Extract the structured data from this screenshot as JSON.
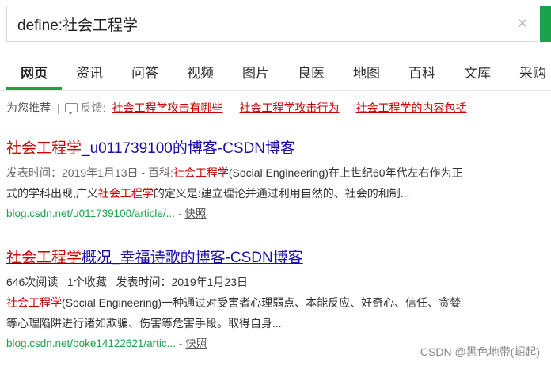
{
  "search": {
    "query": "define:社会工程学",
    "clear_icon": "close-icon"
  },
  "tabs": [
    "网页",
    "资讯",
    "问答",
    "视频",
    "图片",
    "良医",
    "地图",
    "百科",
    "文库",
    "采购"
  ],
  "recommend": {
    "label": "为您推荐",
    "separator": "|",
    "feedback": "反馈:",
    "links": [
      "社会工程学攻击有哪些",
      "社会工程学攻击行为",
      "社会工程学的内容包括"
    ]
  },
  "results": [
    {
      "title_em": "社会工程学",
      "title_rest": "_u011739100的博客-CSDN博客",
      "line1_meta": "发表时间：2019年1月13日 - 百科:",
      "line1_em": "社会工程学",
      "line1_rest": "(Social Engineering)在上世纪60年代左右作为正",
      "line2_pre": "式的学科出现,广义",
      "line2_em": "社会工程学",
      "line2_rest": "的定义是:建立理论并通过利用自然的、社会的和制...",
      "url": "blog.csdn.net/u011739100/article/...",
      "dash": "-",
      "snapshot": "快照"
    },
    {
      "title_em": "社会工程学",
      "title_rest": "概况_幸福诗歌的博客-CSDN博客",
      "meta": "646次阅读   1个收藏   发表时间：2019年1月23日",
      "line1_em": "社会工程学",
      "line1_rest": "(Social Engineering)一种通过对受害者心理弱点、本能反应、好奇心、信任、贪婪",
      "line2": "等心理陷阱进行诸如欺骗、伤害等危害手段。取得自身...",
      "url": "blog.csdn.net/boke14122621/artic...",
      "dash": "-",
      "snapshot": "快照"
    }
  ],
  "watermark": "CSDN @黑色地带(崛起)"
}
